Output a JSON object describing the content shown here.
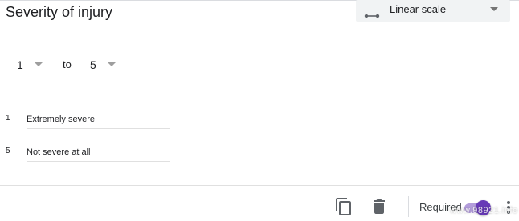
{
  "question": {
    "title": "Severity of injury",
    "type_label": "Linear scale",
    "type_icon": "linear-scale-icon"
  },
  "scale": {
    "min_value": "1",
    "to_label": "to",
    "max_value": "5"
  },
  "labels": [
    {
      "number": "1",
      "value": "Extremely severe"
    },
    {
      "number": "5",
      "value": "Not severe at all"
    }
  ],
  "footer": {
    "duplicate_icon": "duplicate-icon",
    "delete_icon": "trash-icon",
    "required_label": "Required",
    "required_on": true,
    "more_icon": "more-vert-icon",
    "watermark": "www.98921.info"
  },
  "colors": {
    "accent": "#673ab7",
    "accent_track": "#b39ddb",
    "icon": "#757575",
    "select_bg": "#f1f3f4"
  }
}
